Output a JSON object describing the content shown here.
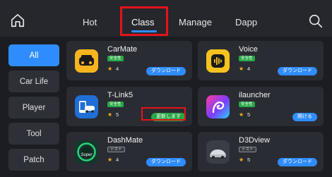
{
  "header": {
    "tabs": [
      {
        "label": "Hot"
      },
      {
        "label": "Class"
      },
      {
        "label": "Manage"
      },
      {
        "label": "Dapp"
      }
    ],
    "active_tab": "Class",
    "accent_color": "#2f8cff",
    "highlight_color": "#e3131b"
  },
  "sidebar": {
    "items": [
      {
        "label": "All"
      },
      {
        "label": "Car Life"
      },
      {
        "label": "Player"
      },
      {
        "label": "Tool"
      },
      {
        "label": "Patch"
      }
    ],
    "active": "All"
  },
  "apps": [
    {
      "name": "CarMate",
      "tag": "安全性",
      "rating": "4",
      "action": "ダウンロード",
      "icon": "carmate-icon"
    },
    {
      "name": "Voice",
      "tag": "安全性",
      "rating": "4",
      "action": "ダウンロード",
      "icon": "voice-icon"
    },
    {
      "name": "T-Link5",
      "tag": "安全性",
      "rating": "5",
      "action": "更新します",
      "icon": "tlink5-icon"
    },
    {
      "name": "ilauncher",
      "tag": "安全性",
      "rating": "5",
      "action": "開ける",
      "icon": "ilauncher-icon"
    },
    {
      "name": "DashMate",
      "tag": "テスト",
      "rating": "4",
      "action": "ダウンロード",
      "icon": "dashmate-icon",
      "icon_text": "Super"
    },
    {
      "name": "D3Dview",
      "tag": "テスト",
      "rating": "5",
      "action": "ダウンロード",
      "icon": "d3dview-icon"
    }
  ]
}
